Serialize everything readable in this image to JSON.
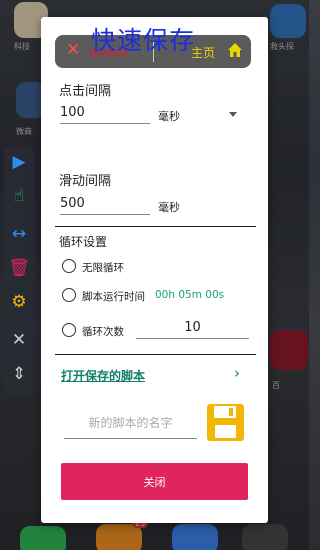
{
  "title": "快速保存",
  "topbar": {
    "close_icon": "close-x-icon",
    "save_hint": "保存脚本",
    "home_label": "主页",
    "home_icon": "home-icon"
  },
  "click_interval": {
    "label": "点击间隔",
    "value": "100",
    "unit": "毫秒"
  },
  "swipe_interval": {
    "label": "滑动间隔",
    "value": "500",
    "unit": "毫秒"
  },
  "loop": {
    "label": "循环设置",
    "options": [
      {
        "label": "无限循环"
      },
      {
        "label": "脚本运行时间",
        "value": "00h 05m 00s"
      },
      {
        "label": "循环次数",
        "value": "10"
      }
    ]
  },
  "open_saved": {
    "label": "打开保存的脚本"
  },
  "script_name": {
    "placeholder": "新的脚本的名字"
  },
  "close_button": {
    "label": "关闭"
  },
  "background": {
    "app_labels": [
      "科技",
      "微商",
      "救头探"
    ],
    "badge": "23",
    "app_label_right": "百"
  },
  "colors": {
    "accent_pink": "#e0245e",
    "link_green": "#127f6c",
    "time_green": "#1ba17f",
    "title_blue": "#1b2fe0",
    "home_yellow": "#e8d800",
    "save_icon_yellow": "#f2b705"
  }
}
